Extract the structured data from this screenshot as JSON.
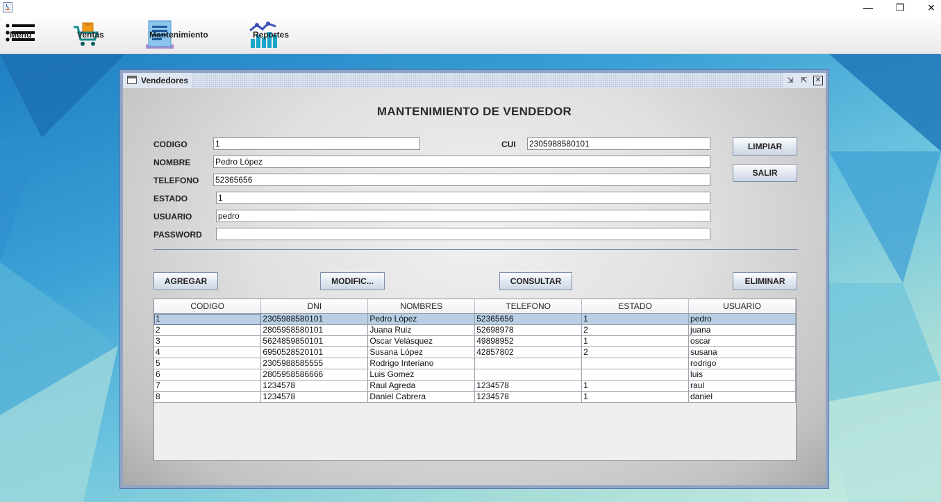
{
  "menubar": {
    "items": [
      {
        "label": "Menu",
        "icon": "hamburger-menu-icon"
      },
      {
        "label": "Ventas",
        "icon": "shopping-cart-icon"
      },
      {
        "label": "Mantenimiento",
        "icon": "document-list-icon"
      },
      {
        "label": "Reportes",
        "icon": "bar-chart-icon"
      }
    ]
  },
  "window_controls": {
    "minimize": "—",
    "maximize": "❐",
    "close": "✕"
  },
  "frame": {
    "title": "Vendedores"
  },
  "form": {
    "heading": "MANTENIMIENTO DE VENDEDOR",
    "codigo": {
      "label": "CODIGO",
      "value": "1"
    },
    "cui": {
      "label": "CUI",
      "value": "2305988580101"
    },
    "nombre": {
      "label": "NOMBRE",
      "value": "Pedro López"
    },
    "telefono": {
      "label": "TELEFONO",
      "value": "52365656"
    },
    "estado": {
      "label": "ESTADO",
      "value": "1"
    },
    "usuario": {
      "label": "USUARIO",
      "value": "pedro"
    },
    "password": {
      "label": "PASSWORD",
      "value": ""
    }
  },
  "buttons": {
    "limpiar": "LIMPIAR",
    "salir": "SALIR",
    "agregar": "AGREGAR",
    "modificar": "MODIFIC...",
    "consultar": "CONSULTAR",
    "eliminar": "ELIMINAR"
  },
  "table": {
    "columns": [
      "CODIGO",
      "DNI",
      "NOMBRES",
      "TELEFONO",
      "ESTADO",
      "USUARIO"
    ],
    "rows": [
      [
        "1",
        "2305988580101",
        "Pedro López",
        "52365656",
        "1",
        "pedro"
      ],
      [
        "2",
        "2805958580101",
        "Juana Ruiz",
        "52698978",
        "2",
        "juana"
      ],
      [
        "3",
        "5624859850101",
        "Oscar Velásquez",
        "49898952",
        "1",
        "oscar"
      ],
      [
        "4",
        "6950528520101",
        "Susana López",
        "42857802",
        "2",
        "susana"
      ],
      [
        "5",
        "2305988585555",
        "Rodrigo Interiano",
        "",
        "",
        "rodrigo"
      ],
      [
        "6",
        "2805958586666",
        "Luis Gomez",
        "",
        "",
        "luis"
      ],
      [
        "7",
        "1234578",
        "Raul Agreda",
        "1234578",
        "1",
        "raul"
      ],
      [
        "8",
        "1234578",
        "Daniel Cabrera",
        "1234578",
        "1",
        "daniel"
      ]
    ],
    "selected_row": 0
  }
}
